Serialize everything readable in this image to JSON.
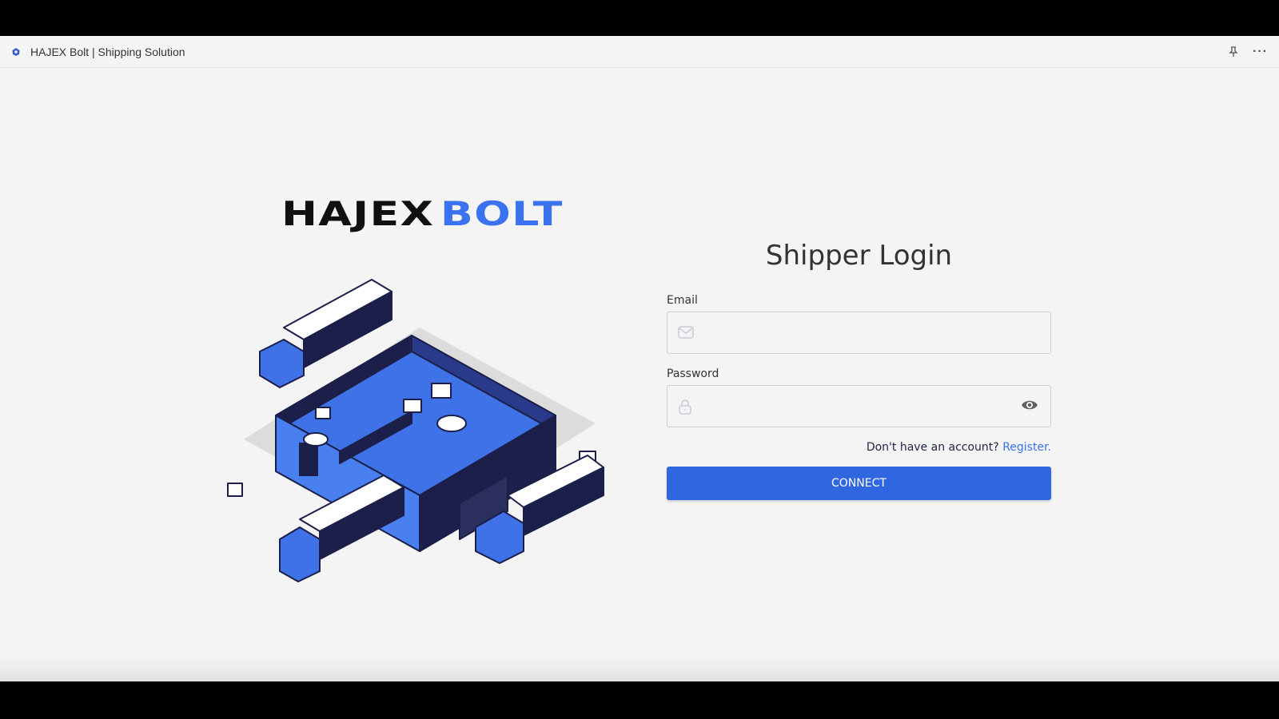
{
  "window": {
    "title": "HAJEX Bolt | Shipping Solution",
    "icons": {
      "app": "app-logo-icon",
      "pin": "pin-icon",
      "more": "more-options-icon"
    },
    "more_glyph": "···"
  },
  "brand": {
    "part1": "HAJEX",
    "part2": "BOLT",
    "accent_color": "#3a72f0"
  },
  "illustration": {
    "alt": "Isometric warehouse with trucks illustration"
  },
  "login": {
    "heading": "Shipper Login",
    "email": {
      "label": "Email",
      "value": "",
      "placeholder": "",
      "icon": "mail-icon"
    },
    "password": {
      "label": "Password",
      "value": "",
      "placeholder": "",
      "icon": "lock-icon",
      "toggle_icon": "eye-icon"
    },
    "register_prompt": "Don't have an account?",
    "register_link": "Register.",
    "submit_label": "CONNECT",
    "button_color": "#3067e0"
  }
}
